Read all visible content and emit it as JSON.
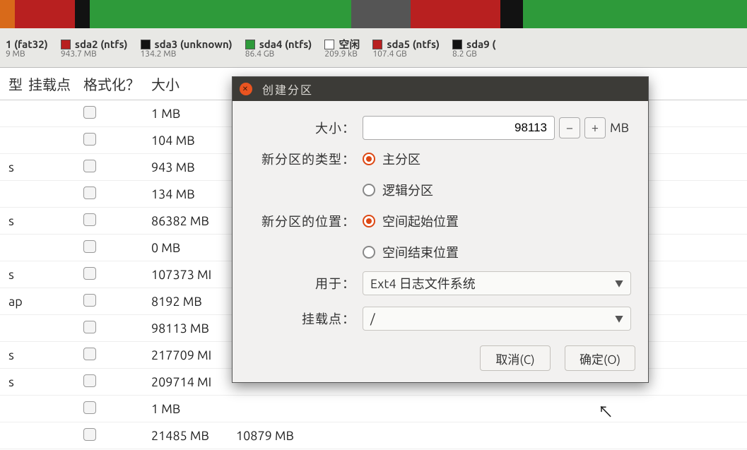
{
  "legend": [
    {
      "swatch": null,
      "name": "1 (fat32)",
      "sub": "9 MB"
    },
    {
      "swatch": "sw-red",
      "name": "sda2 (ntfs)",
      "sub": "943.7 MB"
    },
    {
      "swatch": "sw-black",
      "name": "sda3 (unknown)",
      "sub": "134.2 MB"
    },
    {
      "swatch": "sw-green",
      "name": "sda4 (ntfs)",
      "sub": "86.4 GB"
    },
    {
      "swatch": "sw-grey",
      "name": "空闲",
      "sub": "209.9 kB"
    },
    {
      "swatch": "sw-red2",
      "name": "sda5 (ntfs)",
      "sub": "107.4 GB"
    },
    {
      "swatch": "sw-black",
      "name": "sda9 (",
      "sub": "8.2 GB"
    }
  ],
  "table": {
    "headers": {
      "type": "型",
      "mount": "挂载点",
      "fmt": "格式化？",
      "size": "大小"
    },
    "rows": [
      {
        "type": "",
        "size": "1 MB",
        "extra": ""
      },
      {
        "type": "",
        "size": "104 MB",
        "extra": ""
      },
      {
        "type": "s",
        "size": "943 MB",
        "extra": ""
      },
      {
        "type": "",
        "size": "134 MB",
        "extra": ""
      },
      {
        "type": "s",
        "size": "86382 MB",
        "extra": ""
      },
      {
        "type": "",
        "size": "0 MB",
        "extra": ""
      },
      {
        "type": "s",
        "size": "107373 MI",
        "extra": ""
      },
      {
        "type": "ap",
        "size": "8192 MB",
        "extra": ""
      },
      {
        "type": "",
        "size": "98113 MB",
        "extra": ""
      },
      {
        "type": "s",
        "size": "217709 MI",
        "extra": ""
      },
      {
        "type": "s",
        "size": "209714 MI",
        "extra": ""
      },
      {
        "type": "",
        "size": "1 MB",
        "extra": ""
      },
      {
        "type": "",
        "size": "21485 MB",
        "extra": "10879 MB"
      }
    ]
  },
  "dialog": {
    "title": "创建分区",
    "size_label": "大小：",
    "size_value": "98113",
    "size_unit": "MB",
    "type_label": "新分区的类型：",
    "type_primary": "主分区",
    "type_logical": "逻辑分区",
    "loc_label": "新分区的位置：",
    "loc_begin": "空间起始位置",
    "loc_end": "空间结束位置",
    "use_label": "用于：",
    "use_value": "Ext4 日志文件系统",
    "mount_label": "挂载点：",
    "mount_value": "/",
    "cancel": "取消(C)",
    "ok": "确定(O)"
  }
}
